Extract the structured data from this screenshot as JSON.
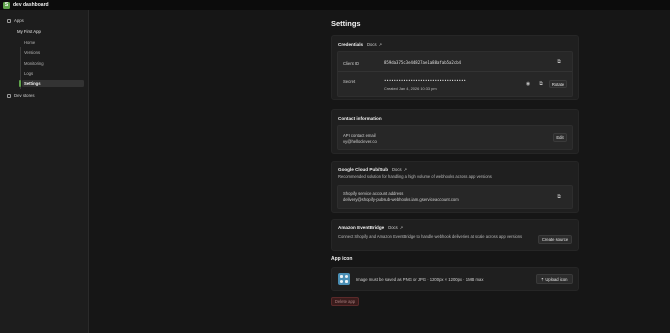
{
  "topbar": {
    "logo_letter": "S",
    "title": "dev dashboard"
  },
  "sidebar": {
    "apps_label": "Apps",
    "app_name": "My First App",
    "items": [
      {
        "label": "Home"
      },
      {
        "label": "Versions"
      },
      {
        "label": "Monitoring"
      },
      {
        "label": "Logs"
      },
      {
        "label": "Settings"
      }
    ],
    "dev_stores_label": "Dev stores"
  },
  "page": {
    "title": "Settings"
  },
  "credentials": {
    "title": "Credentials",
    "docs_label": "Docs",
    "client_id_label": "Client ID",
    "client_id_value": "859da375c3e44827ae1a88afab5a2cb4",
    "secret_label": "Secret",
    "secret_value": "••••••••••••••••••••••••••••••••••",
    "created_text": "Created Jan 4, 2026 10:33 pm",
    "rotate_label": "Rotate"
  },
  "contact": {
    "title": "Contact information",
    "email_label": "API contact email",
    "email_value": "vy@helloclever.co",
    "edit_label": "Edit"
  },
  "pubsub": {
    "title": "Google Cloud Pub/Sub",
    "docs_label": "Docs",
    "description": "Recommended solution for handling a high volume of webhooks across app versions",
    "account_label": "Shopify service account address",
    "account_value": "delivery@shopify-pubsub-webhooks.iam.gserviceaccount.com"
  },
  "eventbridge": {
    "title": "Amazon EventBridge",
    "docs_label": "Docs",
    "description": "Connect Shopify and Amazon EventBridge to handle webhook deliveries at scale across app versions",
    "create_label": "Create source"
  },
  "app_icon": {
    "title": "App icon",
    "hint": "Image must be saved as PNG or JPG · 1200px × 1200px · 1MB max",
    "upload_label": "Upload icon"
  },
  "delete_label": "Delete app",
  "colors": {
    "accent": "#5fa34b",
    "background": "#161616",
    "card": "#1f1f1f",
    "icon_tile": "#4a8fb5"
  }
}
